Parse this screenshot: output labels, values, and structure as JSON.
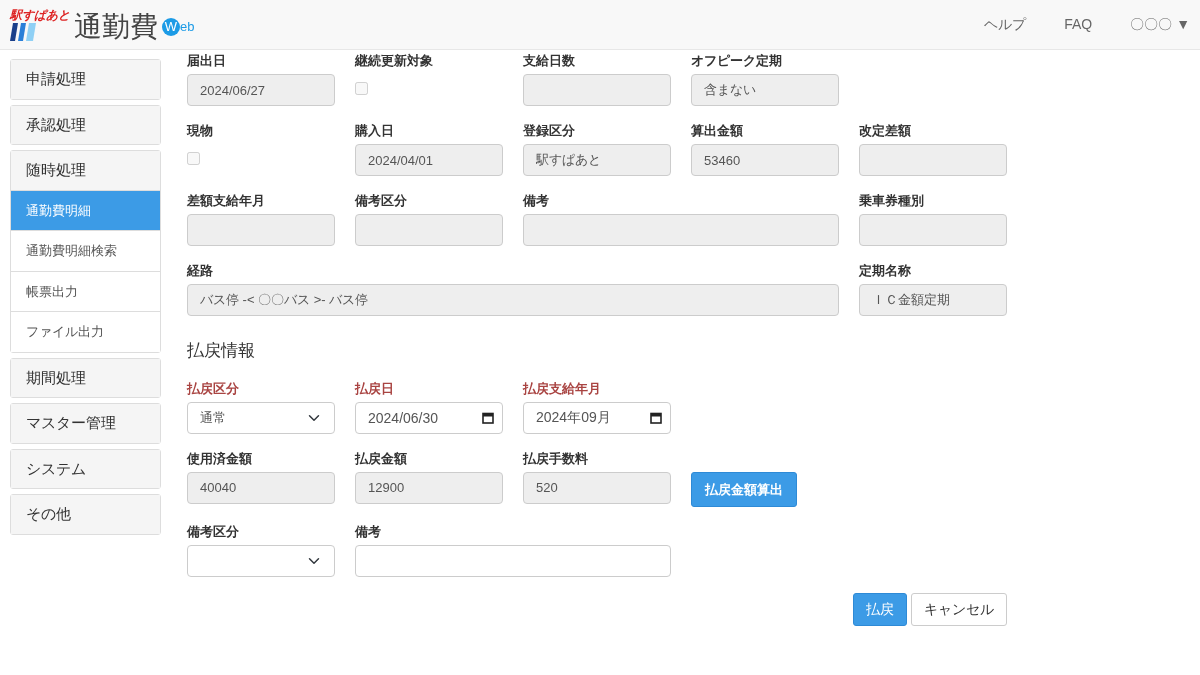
{
  "header": {
    "logo_tagline": "駅すぱあと",
    "logo_title": "通勤費",
    "logo_badge": "W",
    "logo_suffix": "eb",
    "nav": [
      "ヘルプ",
      "FAQ"
    ],
    "user": "〇〇〇",
    "user_caret": "▼"
  },
  "sidebar": [
    {
      "label": "申請処理"
    },
    {
      "label": "承認処理"
    },
    {
      "label": "随時処理",
      "children": [
        {
          "label": "通勤費明細",
          "selected": true
        },
        {
          "label": "通勤費明細検索",
          "selected": false
        },
        {
          "label": "帳票出力",
          "selected": false
        },
        {
          "label": "ファイル出力",
          "selected": false
        }
      ]
    },
    {
      "label": "期間処理"
    },
    {
      "label": "マスター管理"
    },
    {
      "label": "システム"
    },
    {
      "label": "その他"
    }
  ],
  "detail_rows": [
    [
      {
        "kind": "text",
        "label": "届出日",
        "value": "2024/06/27",
        "readonly": true,
        "required": false
      },
      {
        "kind": "checkbox",
        "label": "継続更新対象",
        "checked": false,
        "readonly": true,
        "required": false
      },
      {
        "kind": "text",
        "label": "支給日数",
        "readonly": true,
        "required": false
      },
      {
        "kind": "text",
        "label": "オフピーク定期",
        "value": "含まない",
        "readonly": true,
        "required": false
      }
    ],
    [
      {
        "kind": "checkbox",
        "label": "現物",
        "checked": false,
        "readonly": true,
        "required": false
      },
      {
        "kind": "text",
        "label": "購入日",
        "value": "2024/04/01",
        "readonly": true,
        "required": false
      },
      {
        "kind": "text",
        "label": "登録区分",
        "value": "駅すぱあと",
        "readonly": true,
        "required": false
      },
      {
        "kind": "text",
        "label": "算出金額",
        "value": "53460",
        "readonly": true,
        "required": false
      },
      {
        "kind": "text",
        "label": "改定差額",
        "readonly": true,
        "required": false
      }
    ],
    [
      {
        "kind": "text",
        "label": "差額支給年月",
        "readonly": true,
        "required": false
      },
      {
        "kind": "select",
        "label": "備考区分",
        "readonly": true,
        "required": false
      },
      {
        "kind": "text",
        "label": "備考",
        "readonly": true,
        "required": false
      },
      {
        "kind": "text",
        "label": "乗車券種別",
        "readonly": true,
        "required": false
      }
    ],
    [
      {
        "kind": "text",
        "label": "経路",
        "value": "バス停 -< 〇〇バス >- バス停",
        "readonly": true,
        "required": false
      },
      {
        "kind": "text",
        "label": "定期名称",
        "value": "ＩＣ金額定期",
        "readonly": true,
        "required": false
      }
    ]
  ],
  "refund": {
    "heading": "払戻情報",
    "rows": [
      [
        {
          "kind": "select",
          "label": "払戻区分",
          "value": "通常",
          "readonly": false,
          "required": true
        },
        {
          "kind": "date",
          "label": "払戻日",
          "value": "2024/06/30",
          "readonly": false,
          "required": true
        },
        {
          "kind": "date",
          "label": "払戻支給年月",
          "value": "2024年09月",
          "readonly": false,
          "required": true
        }
      ],
      [
        {
          "kind": "text",
          "label": "使用済金額",
          "value": "40040",
          "readonly": true,
          "required": false
        },
        {
          "kind": "text",
          "label": "払戻金額",
          "value": "12900",
          "readonly": true,
          "required": false
        },
        {
          "kind": "text",
          "label": "払戻手数料",
          "value": "520",
          "readonly": true,
          "required": false
        },
        {
          "kind": "button",
          "value": "払戻金額算出"
        }
      ],
      [
        {
          "kind": "select",
          "label": "備考区分",
          "readonly": false,
          "required": false
        },
        {
          "kind": "text",
          "label": "備考",
          "readonly": false,
          "required": false
        }
      ]
    ]
  },
  "actions": [
    {
      "label": "払戻",
      "primary": true
    },
    {
      "label": "キャンセル",
      "primary": false
    }
  ]
}
